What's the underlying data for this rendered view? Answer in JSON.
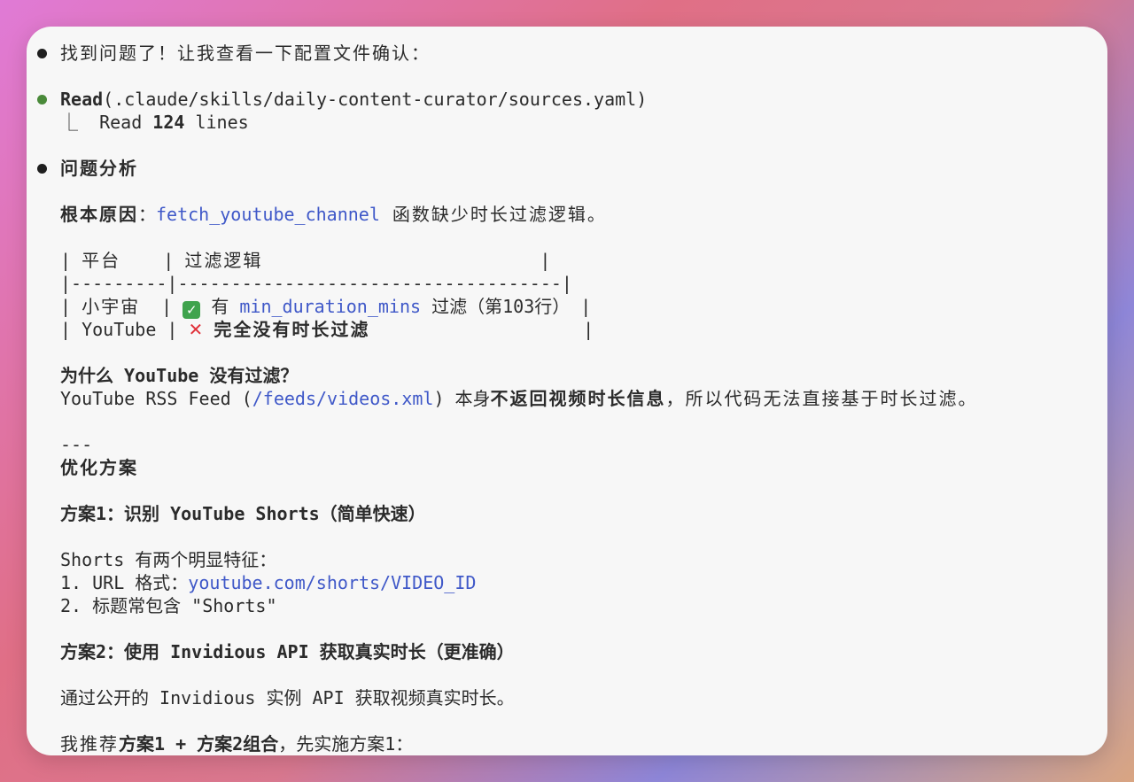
{
  "messages": {
    "intro": "找到问题了！让我查看一下配置文件确认：",
    "tool_call": {
      "name": "Read",
      "arg": "(.claude/skills/daily-content-curator/sources.yaml)",
      "result_prefix": "⎿  Read ",
      "result_count": "124",
      "result_suffix": " lines"
    },
    "analysis_heading": "问题分析",
    "root_cause_label": "根本原因",
    "root_cause_colon": "：",
    "root_cause_func": "fetch_youtube_channel",
    "root_cause_text": " 函数缺少时长过滤逻辑。",
    "table": {
      "header_pipe": "| ",
      "col1_header": "平台",
      "col2_header": "过滤逻辑",
      "separator": "|---------|------------------------------------|",
      "row1_platform": "小宇宙",
      "row1_check": "✓",
      "row1_has": "有",
      "row1_field": "min_duration_mins",
      "row1_note": "过滤（第103行）",
      "row2_platform": "YouTube",
      "row2_cross": "✕",
      "row2_note": "完全没有时长过滤"
    },
    "why_heading": "为什么 YouTube 没有过滤？",
    "why_pre": "YouTube RSS Feed (",
    "why_link": "/feeds/videos.xml",
    "why_mid": ") 本身",
    "why_bold": "不返回视频时长信息",
    "why_post": "，所以代码无法直接基于时长过滤。",
    "divider": "---",
    "optimize_heading": "优化方案",
    "plan1_heading": "方案1：识别 YouTube Shorts（简单快速）",
    "shorts_intro": "Shorts 有两个明显特征：",
    "shorts_item1_pre": "1. URL 格式：",
    "shorts_item1_link": "youtube.com/shorts/VIDEO_ID",
    "shorts_item2": "2. 标题常包含 \"Shorts\"",
    "plan2_heading": "方案2：使用 Invidious API 获取真实时长（更准确）",
    "plan2_text": "通过公开的 Invidious 实例 API 获取视频真实时长。",
    "recommend_pre": "我推荐",
    "recommend_bold": "方案1 + 方案2组合",
    "recommend_post": "，先实施方案1："
  },
  "colors": {
    "link": "#3f58c8",
    "bullet_success": "#4a8a3a",
    "check": "#3fa34d",
    "cross": "#e0313a"
  },
  "icons": {
    "check": "check-mark-icon",
    "cross": "cross-mark-icon"
  }
}
